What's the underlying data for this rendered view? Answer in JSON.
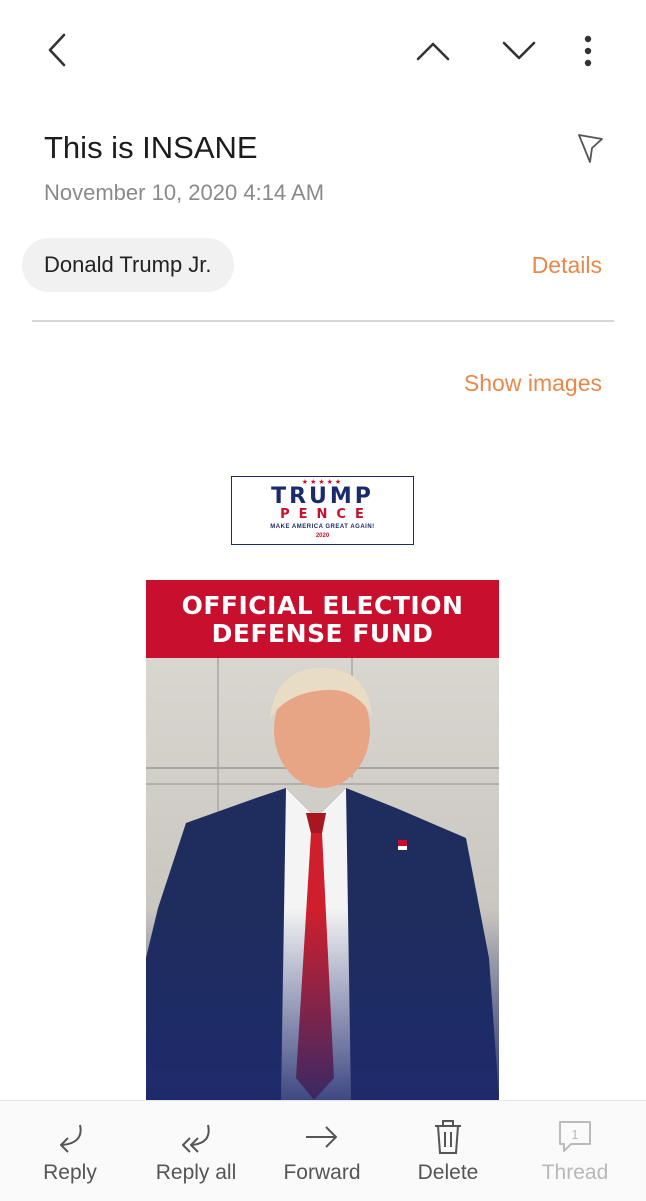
{
  "email": {
    "subject": "This is INSANE",
    "date": "November 10, 2020  4:14 AM",
    "sender": "Donald Trump Jr.",
    "details_label": "Details",
    "show_images_label": "Show images"
  },
  "logo": {
    "stars": "★★★★★",
    "line1": "TRUMP",
    "line2": "PENCE",
    "line3": "MAKE AMERICA GREAT AGAIN!",
    "line4": "2020"
  },
  "promo": {
    "header_line1": "OFFICIAL ELECTION",
    "header_line2": "DEFENSE FUND"
  },
  "bottom_actions": [
    {
      "label": "Reply",
      "icon": "reply-icon",
      "enabled": true
    },
    {
      "label": "Reply all",
      "icon": "reply-all-icon",
      "enabled": true
    },
    {
      "label": "Forward",
      "icon": "forward-icon",
      "enabled": true
    },
    {
      "label": "Delete",
      "icon": "trash-icon",
      "enabled": true
    },
    {
      "label": "Thread",
      "icon": "thread-icon",
      "badge": "1",
      "enabled": false
    }
  ],
  "colors": {
    "accent": "#e8884a",
    "promo_red": "#c8102e",
    "navy": "#1b2a6b"
  }
}
